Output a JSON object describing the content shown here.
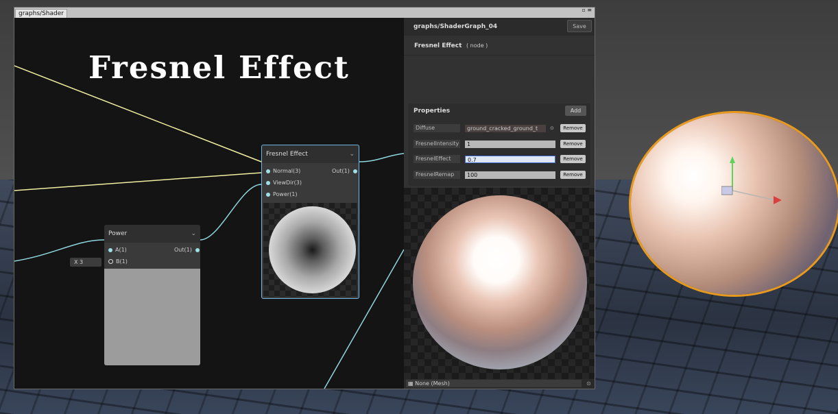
{
  "window": {
    "tab_label": "graphs/Shader",
    "controls": "▫ ≡"
  },
  "canvas": {
    "title": "Fresnel Effect"
  },
  "nodes": {
    "fresnel": {
      "title": "Fresnel Effect",
      "inputs": [
        "Normal(3)",
        "ViewDir(3)",
        "Power(1)"
      ],
      "output": "Out(1)"
    },
    "power": {
      "title": "Power",
      "inputs": [
        "A(1)",
        "B(1)"
      ],
      "output": "Out(1)",
      "b_value": "X 3"
    }
  },
  "panel": {
    "graph_path": "graphs/ShaderGraph_04",
    "save_label": "Save",
    "selected_name": "Fresnel Effect",
    "selected_type": "( node )",
    "properties_label": "Properties",
    "add_label": "Add",
    "remove_label": "Remove",
    "properties": [
      {
        "name": "Diffuse",
        "value": "ground_cracked_ground_t"
      },
      {
        "name": "FresnelIntensity",
        "value": "1"
      },
      {
        "name": "FresnelEffect",
        "value": "0.7"
      },
      {
        "name": "FresnelRemap",
        "value": "100"
      }
    ],
    "mesh_field": "None (Mesh)"
  },
  "colors": {
    "selection_border": "#6fb7e4",
    "wire_yellow": "#f2f0a0",
    "wire_cyan": "#8fd8e0",
    "scene_outline": "#e89a1e"
  }
}
